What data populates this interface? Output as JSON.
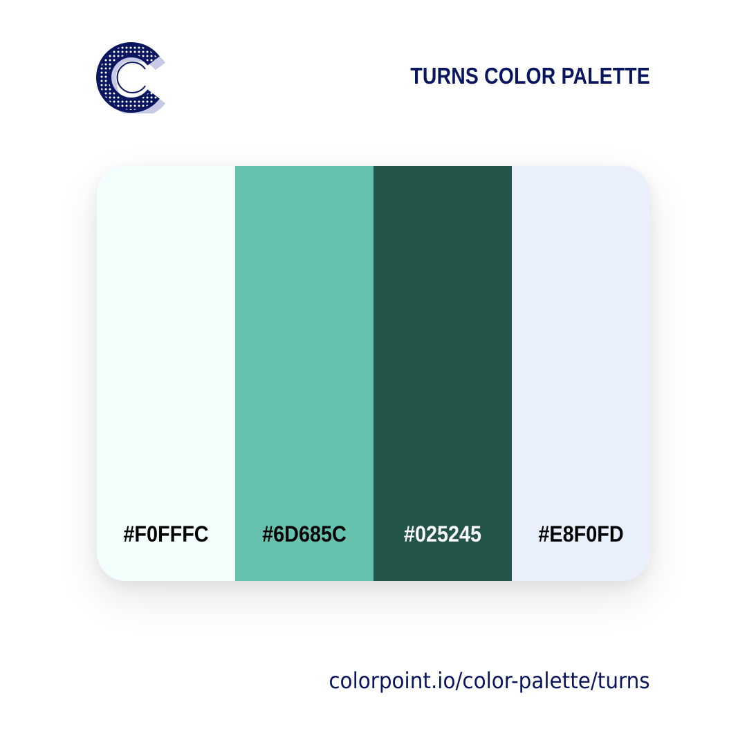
{
  "brand": {
    "logo_icon": "colorpoint-c-logo-icon",
    "color": "#0a1560"
  },
  "title": "TURNS COLOR PALETTE",
  "swatches": [
    {
      "hex": "#F0FFFC",
      "fill": "#F2FFFC",
      "text_color": "#000000"
    },
    {
      "hex": "#6D685C",
      "fill": "#66C1AE",
      "text_color": "#000000"
    },
    {
      "hex": "#025245",
      "fill": "#235449",
      "text_color": "#FFFFFF"
    },
    {
      "hex": "#E8F0FD",
      "fill": "#E9F0FC",
      "text_color": "#000000"
    }
  ],
  "footer": {
    "url": "colorpoint.io/color-palette/turns"
  }
}
